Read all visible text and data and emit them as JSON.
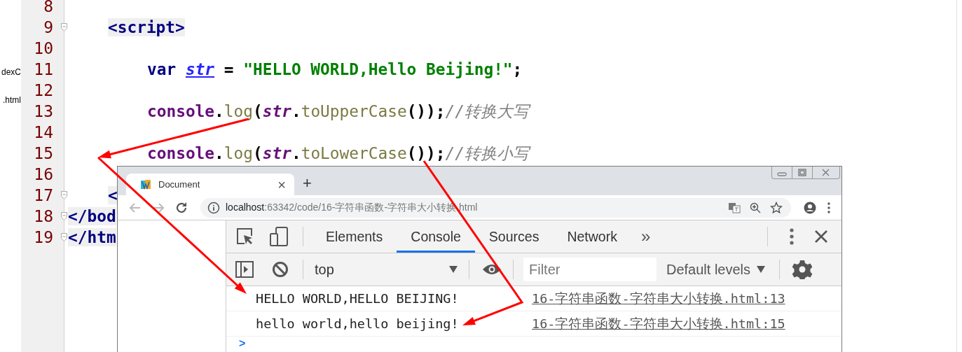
{
  "file_tree": [
    {
      "label": "dexC"
    },
    {
      "label": ".html"
    }
  ],
  "editor": {
    "lines": [
      {
        "number": "8",
        "foldable": false
      },
      {
        "number": "9",
        "foldable": true,
        "kind": "tag",
        "tokens": [
          {
            "kind": "tag",
            "text": "<script>"
          }
        ]
      },
      {
        "number": "10",
        "foldable": false
      },
      {
        "number": "11",
        "foldable": false,
        "kind": "script",
        "tokens": [
          {
            "kind": "keyword",
            "text": "var "
          },
          {
            "kind": "decl",
            "text": "str"
          },
          {
            "kind": "plain",
            "text": " = "
          },
          {
            "kind": "string",
            "text": "\"HELLO WORLD,Hello Beijing!\""
          },
          {
            "kind": "plain",
            "text": ";"
          }
        ]
      },
      {
        "number": "12",
        "foldable": false
      },
      {
        "number": "13",
        "foldable": false,
        "kind": "script",
        "tokens": [
          {
            "kind": "object",
            "text": "console"
          },
          {
            "kind": "plain",
            "text": "."
          },
          {
            "kind": "method",
            "text": "log"
          },
          {
            "kind": "plain",
            "text": "("
          },
          {
            "kind": "ref",
            "text": "str"
          },
          {
            "kind": "plain",
            "text": "."
          },
          {
            "kind": "method",
            "text": "toUpperCase"
          },
          {
            "kind": "plain",
            "text": "());"
          },
          {
            "kind": "comment",
            "text": "//转换大写"
          }
        ]
      },
      {
        "number": "14",
        "foldable": false
      },
      {
        "number": "15",
        "foldable": false,
        "kind": "script",
        "tokens": [
          {
            "kind": "object",
            "text": "console"
          },
          {
            "kind": "plain",
            "text": "."
          },
          {
            "kind": "method",
            "text": "log"
          },
          {
            "kind": "plain",
            "text": "("
          },
          {
            "kind": "ref",
            "text": "str"
          },
          {
            "kind": "plain",
            "text": "."
          },
          {
            "kind": "method",
            "text": "toLowerCase"
          },
          {
            "kind": "plain",
            "text": "());"
          },
          {
            "kind": "comment",
            "text": "//转换小写"
          }
        ]
      },
      {
        "number": "16",
        "foldable": false
      },
      {
        "number": "17",
        "foldable": true,
        "kind": "tag",
        "tokens": [
          {
            "kind": "tag",
            "text": "<"
          }
        ]
      },
      {
        "number": "18",
        "foldable": true,
        "kind": "html",
        "tokens": [
          {
            "kind": "tag",
            "text": "</bod"
          }
        ]
      },
      {
        "number": "19",
        "foldable": true,
        "kind": "html",
        "tokens": [
          {
            "kind": "tag",
            "text": "</htm"
          }
        ]
      }
    ]
  },
  "browser": {
    "tab": {
      "title": "Document",
      "close": "×"
    },
    "new_tab": "+",
    "address": {
      "host": "localhost",
      "path": ":63342/code/16-字符串函数-字符串大小转换.html"
    },
    "devtools": {
      "tabs": [
        {
          "label": "Elements",
          "selected": false
        },
        {
          "label": "Console",
          "selected": true
        },
        {
          "label": "Sources",
          "selected": false
        },
        {
          "label": "Network",
          "selected": false
        }
      ],
      "more": "»",
      "context": "top",
      "filter": {
        "placeholder": "Filter"
      },
      "levels": "Default levels",
      "messages": [
        {
          "text": "HELLO WORLD,HELLO BEIJING!",
          "source": "16-字符串函数-字符串大小转换.html:13"
        },
        {
          "text": "hello world,hello beijing!",
          "source": "16-字符串函数-字符串大小转换.html:15"
        }
      ],
      "prompt": ">"
    }
  }
}
